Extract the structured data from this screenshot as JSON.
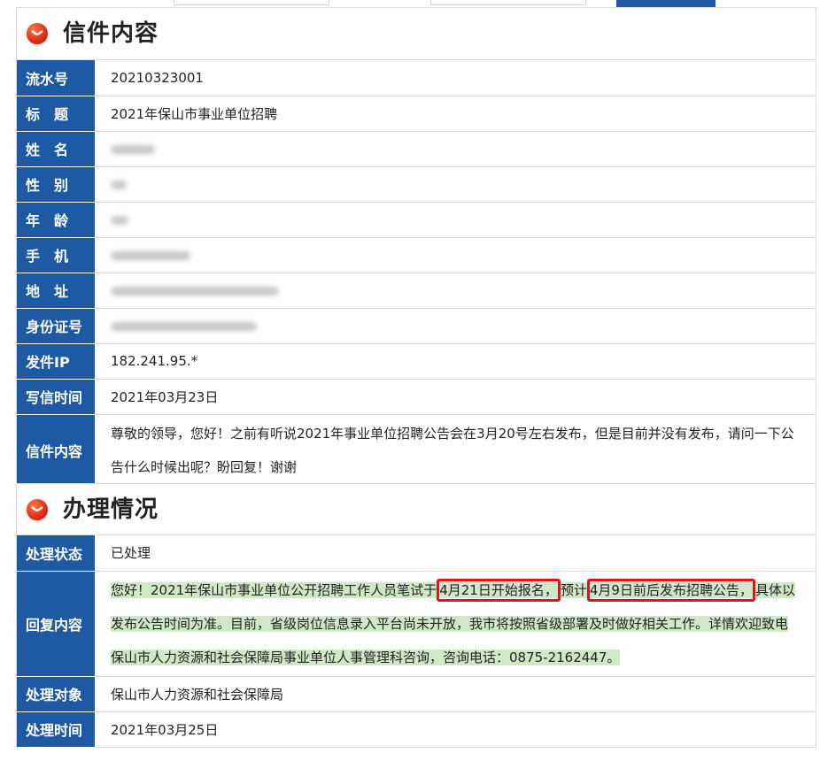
{
  "letter": {
    "section_title": "信件内容",
    "rows": [
      {
        "label": "流水号",
        "value": "20210323001"
      },
      {
        "label": "标　题",
        "value": "2021年保山市事业单位招聘"
      },
      {
        "label": "姓　名",
        "value": ""
      },
      {
        "label": "性　别",
        "value": ""
      },
      {
        "label": "年　龄",
        "value": ""
      },
      {
        "label": "手　机",
        "value": ""
      },
      {
        "label": "地　址",
        "value": ""
      },
      {
        "label": "身份证号",
        "value": ""
      },
      {
        "label": "发件IP",
        "value": "182.241.95.*"
      },
      {
        "label": "写信时间",
        "value": "2021年03月23日"
      }
    ],
    "content_label": "信件内容",
    "content_text": "尊敬的领导，您好！之前有听说2021年事业单位招聘公告会在3月20号左右发布，但是目前并没有发布，请问一下公告什么时候出呢？盼回复！谢谢"
  },
  "process": {
    "section_title": "办理情况",
    "status_label": "处理状态",
    "status_value": "已处理",
    "reply_label": "回复内容",
    "reply": {
      "part1": "您好！2021年保山市事业单位公开招聘工作人员笔试",
      "highlight1_lead": "于",
      "highlight1": "4月21日开始报名，",
      "part2": "预计",
      "highlight2": "4月9日前后发布招聘公告，",
      "part3": "具体以发布公告时间为准。目前，省级岗位信息录入平台尚未开放，我市将按照省级部署及时做好相关工作。详情欢迎致电保山市人力资源和社会保障局事业单位人事管理科咨询，咨询电话：0875-2162447。"
    },
    "target_label": "处理对象",
    "target_value": "保山市人力资源和社会保障局",
    "time_label": "处理时间",
    "time_value": "2021年03月25日"
  },
  "colors": {
    "label_bg": "#1e5aa4",
    "highlight": "#cfe8c6",
    "annotation": "#e0141b"
  }
}
